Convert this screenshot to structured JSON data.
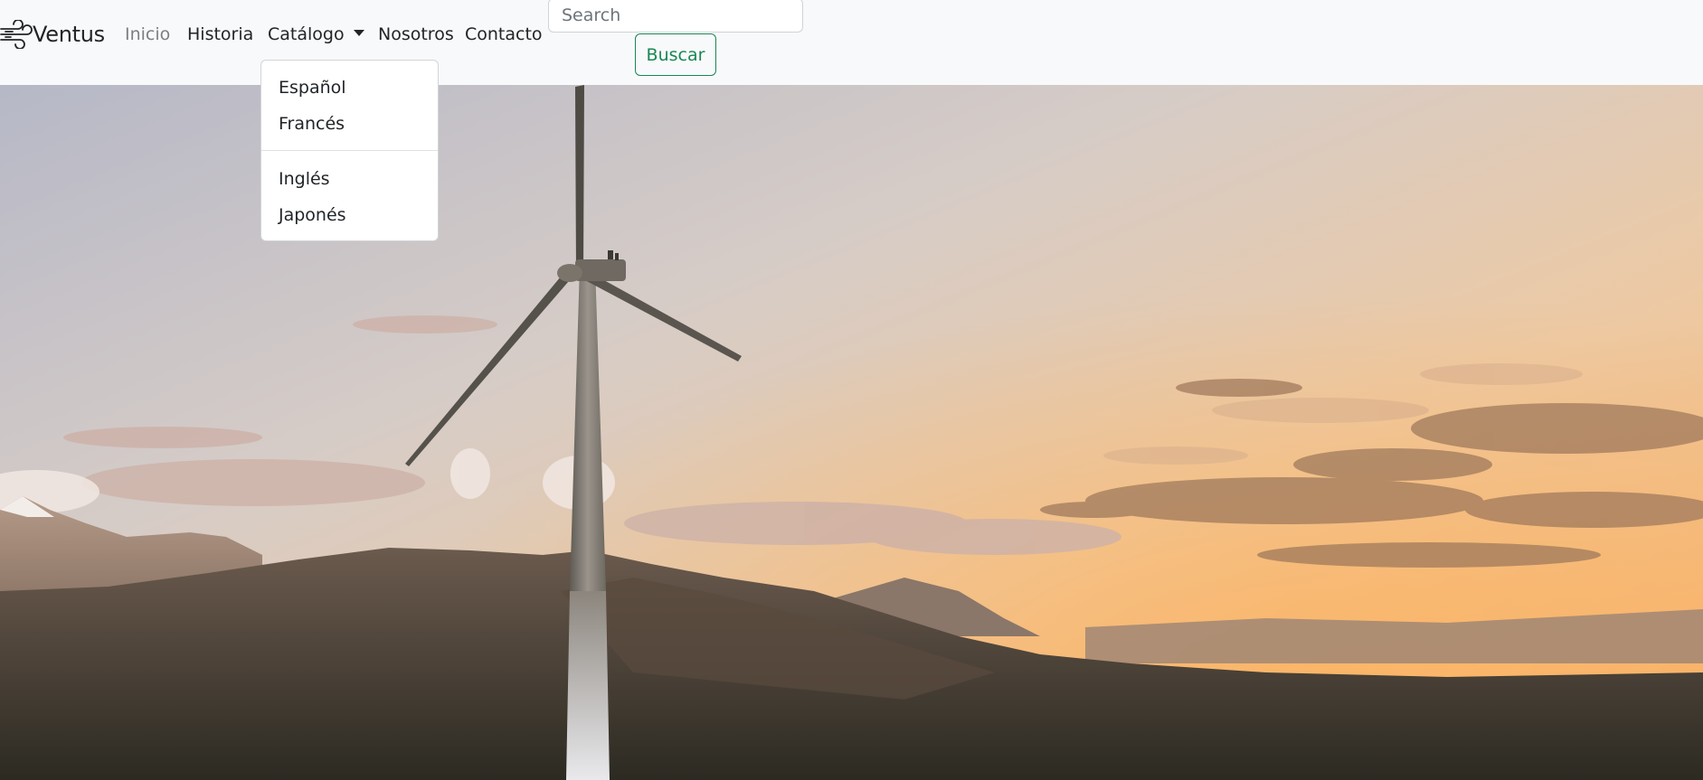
{
  "navbar": {
    "brand": {
      "text": "Ventus",
      "icon": "wind-icon"
    },
    "links": {
      "inicio": "Inicio",
      "historia": "Historia",
      "catalogo": "Catálogo",
      "nosotros": "Nosotros",
      "contacto": "Contacto"
    },
    "search": {
      "placeholder": "Search",
      "value": "",
      "button_label": "Buscar"
    }
  },
  "dropdown": {
    "items": [
      "Español",
      "Francés",
      "Inglés",
      "Japonés"
    ]
  },
  "hero": {
    "image": "wind-turbine-sunset-mountains"
  },
  "colors": {
    "navbar_bg": "#f8f9fa",
    "active_link": "#7b7f84",
    "link": "#212529",
    "success": "#198754"
  }
}
